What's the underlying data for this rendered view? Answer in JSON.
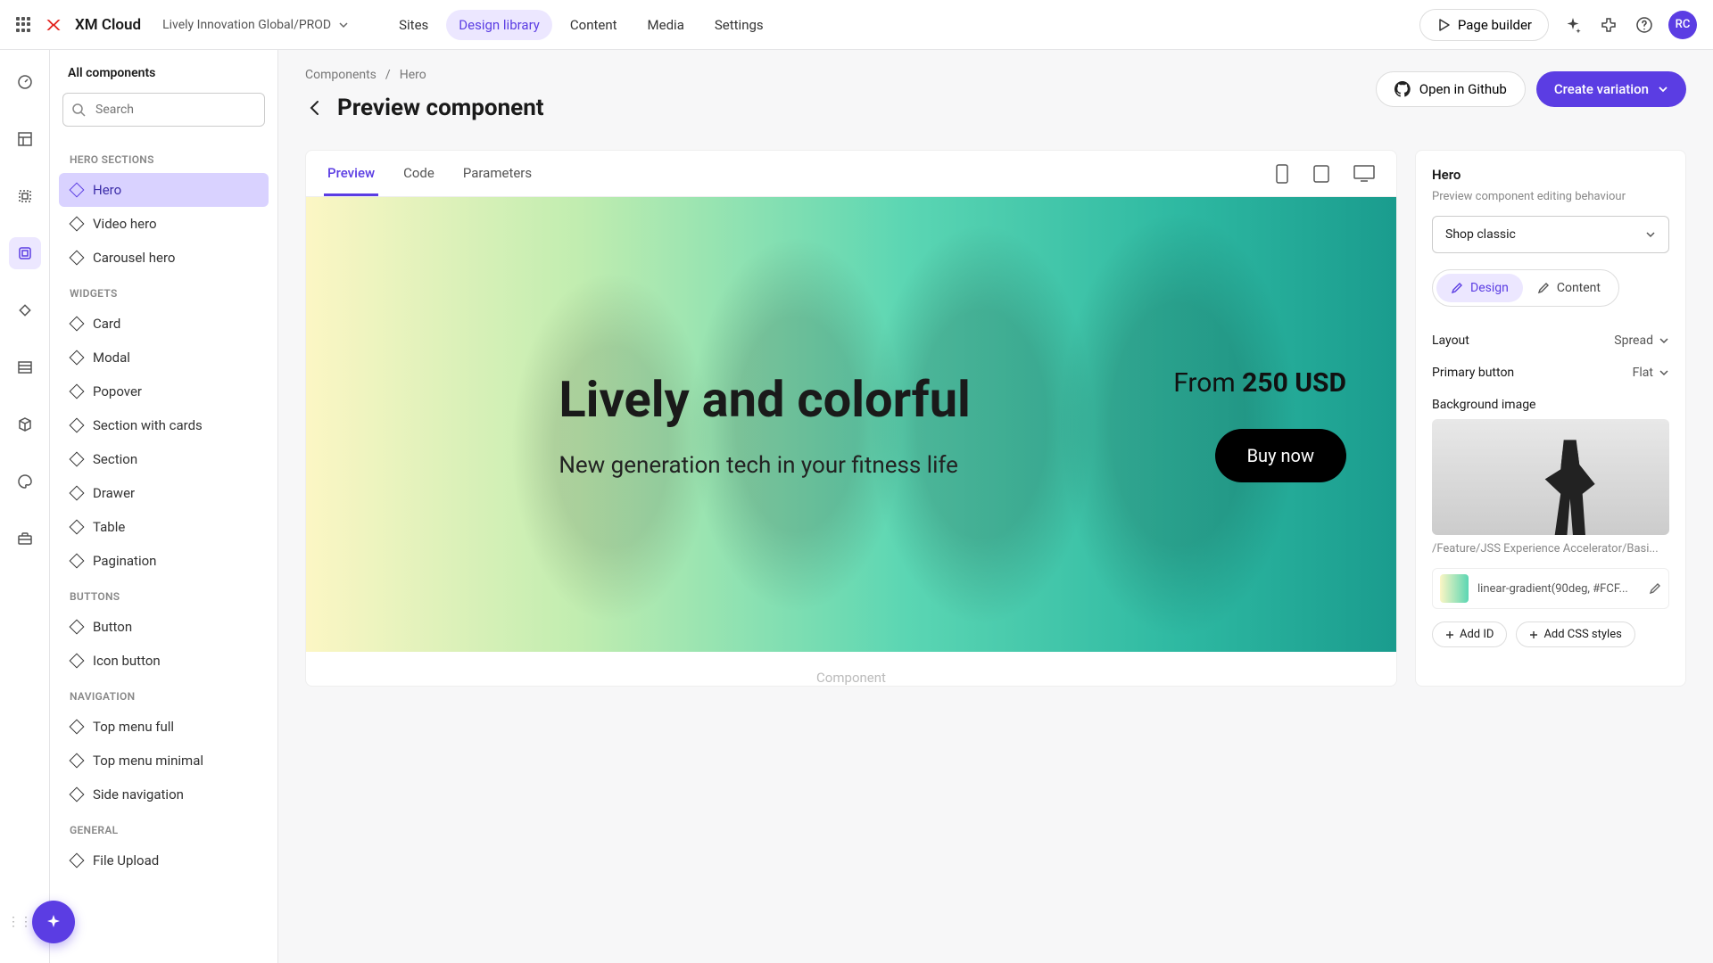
{
  "topbar": {
    "brand": "XM Cloud",
    "project": "Lively Innovation Global/PROD",
    "nav": [
      "Sites",
      "Design library",
      "Content",
      "Media",
      "Settings"
    ],
    "active_nav": 1,
    "page_builder": "Page builder",
    "avatar": "RC"
  },
  "sidebar": {
    "title": "All components",
    "search_placeholder": "Search",
    "groups": [
      {
        "label": "HERO SECTIONS",
        "items": [
          "Hero",
          "Video hero",
          "Carousel hero"
        ],
        "active": 0
      },
      {
        "label": "WIDGETS",
        "items": [
          "Card",
          "Modal",
          "Popover",
          "Section with cards",
          "Section",
          "Drawer",
          "Table",
          "Pagination"
        ]
      },
      {
        "label": "BUTTONS",
        "items": [
          "Button",
          "Icon button"
        ]
      },
      {
        "label": "NAVIGATION",
        "items": [
          "Top menu full",
          "Top menu minimal",
          "Side navigation"
        ]
      },
      {
        "label": "GENERAL",
        "items": [
          "File Upload"
        ]
      }
    ]
  },
  "main": {
    "crumbs": [
      "Components",
      "Hero"
    ],
    "title": "Preview component",
    "open_github": "Open in Github",
    "create_variation": "Create variation",
    "tabs": [
      "Preview",
      "Code",
      "Parameters"
    ],
    "active_tab": 0,
    "component_badge": "Component"
  },
  "hero": {
    "headline": "Lively and colorful",
    "subline": "New generation tech in your fitness life",
    "price_prefix": "From ",
    "price_value": "250 USD",
    "cta": "Buy now"
  },
  "props": {
    "name": "Hero",
    "subtitle": "Preview component editing behaviour",
    "variation": "Shop classic",
    "toggle": {
      "design": "Design",
      "content": "Content",
      "active": "design"
    },
    "layout_label": "Layout",
    "layout_value": "Spread",
    "primary_btn_label": "Primary button",
    "primary_btn_value": "Flat",
    "bg_label": "Background image",
    "bg_path": "/Feature/JSS Experience Accelerator/Basi...",
    "gradient": "linear-gradient(90deg, #FCF...",
    "add_id": "Add ID",
    "add_css": "Add CSS styles"
  }
}
